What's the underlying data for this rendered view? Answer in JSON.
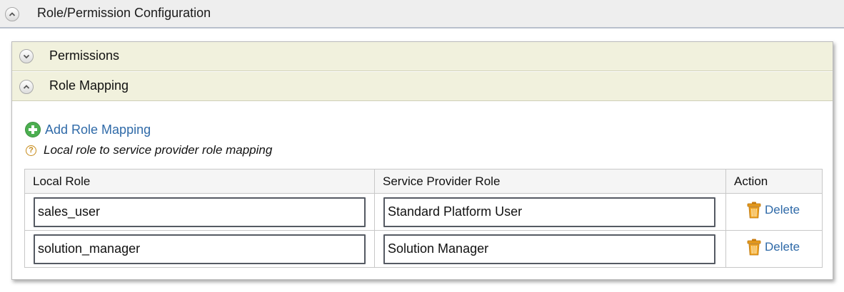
{
  "section": {
    "title": "Role/Permission Configuration"
  },
  "subsections": {
    "permissions": {
      "title": "Permissions"
    },
    "role_mapping": {
      "title": "Role Mapping"
    }
  },
  "add_link": {
    "label": "Add Role Mapping"
  },
  "help": {
    "text": "Local role to service provider role mapping"
  },
  "table": {
    "headers": {
      "local_role": "Local Role",
      "sp_role": "Service Provider Role",
      "action": "Action"
    },
    "rows": [
      {
        "local_role": "sales_user",
        "sp_role": "Standard Platform User",
        "action_label": "Delete"
      },
      {
        "local_role": "solution_manager",
        "sp_role": "Solution Manager",
        "action_label": "Delete"
      }
    ]
  },
  "icons": {
    "collapse": "chevron-up-icon",
    "expand": "chevron-down-icon",
    "add": "plus-circle-icon",
    "help": "question-circle-icon",
    "delete": "trash-icon"
  },
  "colors": {
    "link": "#2f6aa8",
    "subsection_bg": "#f1f1dd",
    "add_icon": "#4caf50",
    "trash": "#e59a1d"
  }
}
